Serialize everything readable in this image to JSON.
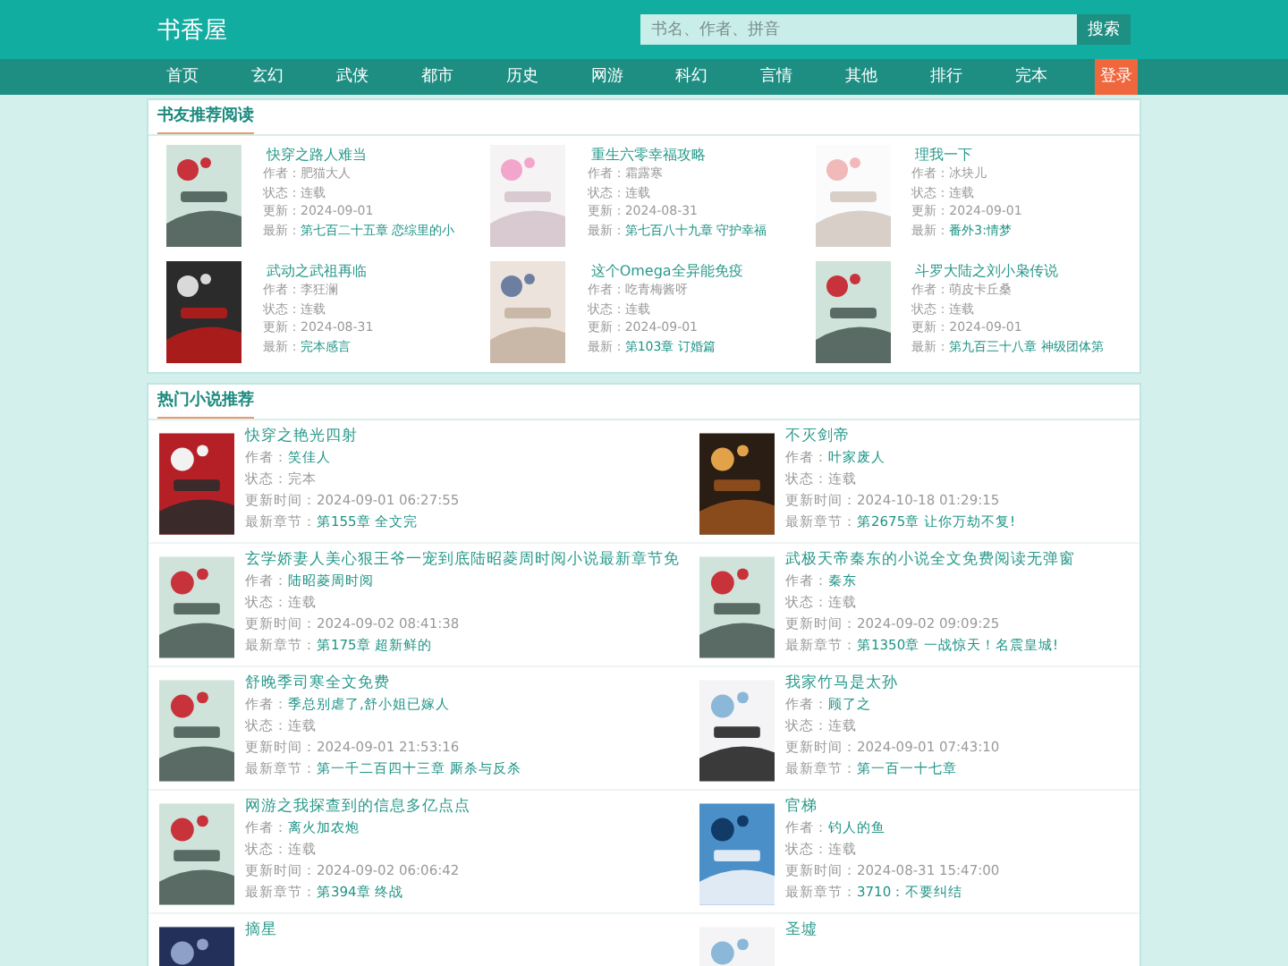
{
  "site": {
    "logo": "书香屋",
    "search_placeholder": "书名、作者、拼音",
    "search_button": "搜索"
  },
  "nav": [
    {
      "label": "首页",
      "kind": "link"
    },
    {
      "label": "玄幻",
      "kind": "link"
    },
    {
      "label": "武侠",
      "kind": "link"
    },
    {
      "label": "都市",
      "kind": "link"
    },
    {
      "label": "历史",
      "kind": "link"
    },
    {
      "label": "网游",
      "kind": "link"
    },
    {
      "label": "科幻",
      "kind": "link"
    },
    {
      "label": "言情",
      "kind": "link"
    },
    {
      "label": "其他",
      "kind": "link"
    },
    {
      "label": "排行",
      "kind": "link"
    },
    {
      "label": "完本",
      "kind": "link"
    },
    {
      "label": "登录",
      "kind": "login"
    }
  ],
  "featured": {
    "title": "书友推荐阅读",
    "books": [
      {
        "title": "快穿之路人难当",
        "author_label": "作者：",
        "author": "肥猫大人",
        "status_label": "状态：",
        "status": "连载",
        "updated_label": "更新：",
        "updated": "2024-09-01",
        "latest_label": "最新：",
        "latest": "第七百二十五章 恋综里的小"
      },
      {
        "title": "重生六零幸福攻略",
        "author_label": "作者：",
        "author": "霜露寒",
        "status_label": "状态：",
        "status": "连载",
        "updated_label": "更新：",
        "updated": "2024-08-31",
        "latest_label": "最新：",
        "latest": "第七百八十九章 守护幸福"
      },
      {
        "title": "理我一下",
        "author_label": "作者：",
        "author": "冰块儿",
        "status_label": "状态：",
        "status": "连载",
        "updated_label": "更新：",
        "updated": "2024-09-01",
        "latest_label": "最新：",
        "latest": "番外3:情梦"
      },
      {
        "title": "武动之武祖再临",
        "author_label": "作者：",
        "author": "李狂澜",
        "status_label": "状态：",
        "status": "连载",
        "updated_label": "更新：",
        "updated": "2024-08-31",
        "latest_label": "最新：",
        "latest": "完本感言"
      },
      {
        "title": "这个Omega全异能免疫",
        "author_label": "作者：",
        "author": "吃青梅酱呀",
        "status_label": "状态：",
        "status": "连载",
        "updated_label": "更新：",
        "updated": "2024-09-01",
        "latest_label": "最新：",
        "latest": "第103章 订婚篇"
      },
      {
        "title": "斗罗大陆之刘小枭传说",
        "author_label": "作者：",
        "author": "萌皮卡丘桑",
        "status_label": "状态：",
        "status": "连载",
        "updated_label": "更新：",
        "updated": "2024-09-01",
        "latest_label": "最新：",
        "latest": "第九百三十八章 神级团体第"
      }
    ]
  },
  "hot": {
    "title": "热门小说推荐",
    "books": [
      {
        "title": "快穿之艳光四射",
        "author_label": "作者：",
        "author": "笑佳人",
        "status_label": "状态：",
        "status": "完本",
        "updated_label": "更新时间：",
        "updated": "2024-09-01 06:27:55",
        "latest_label": "最新章节：",
        "latest": "第155章 全文完"
      },
      {
        "title": "不灭剑帝",
        "author_label": "作者：",
        "author": "叶家废人",
        "status_label": "状态：",
        "status": "连载",
        "updated_label": "更新时间：",
        "updated": "2024-10-18 01:29:15",
        "latest_label": "最新章节：",
        "latest": "第2675章 让你万劫不复!"
      },
      {
        "title": "玄学娇妻人美心狠王爷一宠到底陆昭菱周时阅小说最新章节免",
        "author_label": "作者：",
        "author": "陆昭菱周时阅",
        "status_label": "状态：",
        "status": "连载",
        "updated_label": "更新时间：",
        "updated": "2024-09-02 08:41:38",
        "latest_label": "最新章节：",
        "latest": "第175章 超新鲜的"
      },
      {
        "title": "武极天帝秦东的小说全文免费阅读无弹窗",
        "author_label": "作者：",
        "author": "秦东",
        "status_label": "状态：",
        "status": "连载",
        "updated_label": "更新时间：",
        "updated": "2024-09-02 09:09:25",
        "latest_label": "最新章节：",
        "latest": "第1350章 一战惊天！名震皇城!"
      },
      {
        "title": "舒晚季司寒全文免费",
        "author_label": "作者：",
        "author": "季总别虐了,舒小姐已嫁人",
        "status_label": "状态：",
        "status": "连载",
        "updated_label": "更新时间：",
        "updated": "2024-09-01 21:53:16",
        "latest_label": "最新章节：",
        "latest": "第一千二百四十三章 厮杀与反杀"
      },
      {
        "title": "我家竹马是太孙",
        "author_label": "作者：",
        "author": "顾了之",
        "status_label": "状态：",
        "status": "连载",
        "updated_label": "更新时间：",
        "updated": "2024-09-01 07:43:10",
        "latest_label": "最新章节：",
        "latest": "第一百一十七章"
      },
      {
        "title": "网游之我探查到的信息多亿点点",
        "author_label": "作者：",
        "author": "离火加农炮",
        "status_label": "状态：",
        "status": "连载",
        "updated_label": "更新时间：",
        "updated": "2024-09-02 06:06:42",
        "latest_label": "最新章节：",
        "latest": "第394章 终战"
      },
      {
        "title": "官梯",
        "author_label": "作者：",
        "author": "钓人的鱼",
        "status_label": "状态：",
        "status": "连载",
        "updated_label": "更新时间：",
        "updated": "2024-08-31 15:47:00",
        "latest_label": "最新章节：",
        "latest": "3710：不要纠结"
      },
      {
        "title": "摘星"
      },
      {
        "title": "圣墟"
      }
    ]
  }
}
